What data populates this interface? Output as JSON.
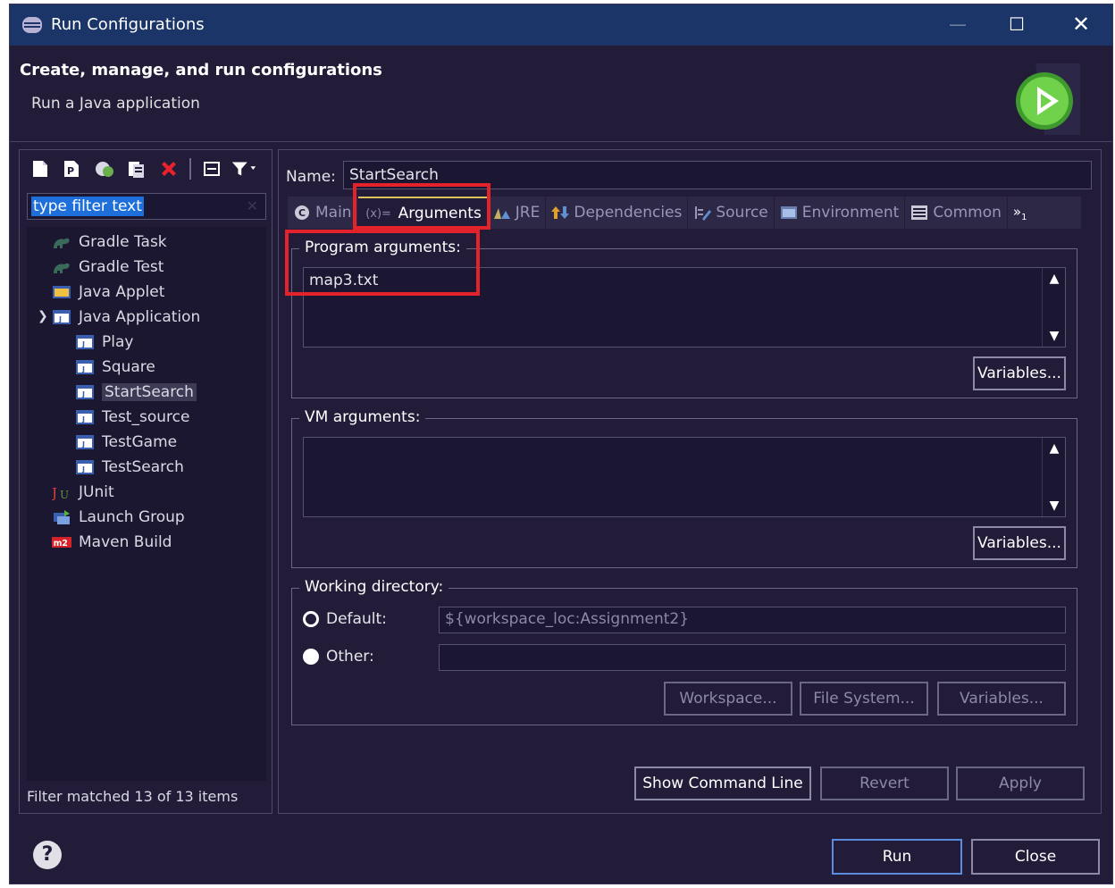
{
  "window": {
    "title": "Run Configurations",
    "controls": {
      "minimize": "—",
      "maximize": "☐",
      "close": "✕"
    }
  },
  "header": {
    "title": "Create, manage, and run configurations",
    "subtitle": "Run a Java application"
  },
  "left": {
    "filter_text": "type filter text",
    "toolbar": [
      "new-configuration-icon",
      "new-prototype-icon",
      "duplicate-icon",
      "export-icon",
      "delete-icon",
      "collapse-all-icon",
      "filter-icon"
    ],
    "tree": [
      {
        "label": "Gradle Task",
        "icon": "gradle-icon",
        "level": 0
      },
      {
        "label": "Gradle Test",
        "icon": "gradle-icon",
        "level": 0
      },
      {
        "label": "Java Applet",
        "icon": "applet-icon",
        "level": 0
      },
      {
        "label": "Java Application",
        "icon": "java-app-icon",
        "level": 0,
        "expanded": true
      },
      {
        "label": "Play",
        "icon": "java-app-icon",
        "level": 1
      },
      {
        "label": "Square",
        "icon": "java-app-icon",
        "level": 1
      },
      {
        "label": "StartSearch",
        "icon": "java-app-icon",
        "level": 1,
        "selected": true
      },
      {
        "label": "Test_source",
        "icon": "java-app-icon",
        "level": 1
      },
      {
        "label": "TestGame",
        "icon": "java-app-icon",
        "level": 1
      },
      {
        "label": "TestSearch",
        "icon": "java-app-icon",
        "level": 1
      },
      {
        "label": "JUnit",
        "icon": "junit-icon",
        "level": 0
      },
      {
        "label": "Launch Group",
        "icon": "launch-group-icon",
        "level": 0
      },
      {
        "label": "Maven Build",
        "icon": "maven-icon",
        "level": 0
      }
    ],
    "status": "Filter matched 13 of 13 items"
  },
  "right": {
    "name_label": "Name:",
    "name_value": "StartSearch",
    "tabs": [
      {
        "label": "Main",
        "icon": "main-tab-icon"
      },
      {
        "label": "Arguments",
        "icon": "arguments-tab-icon",
        "prefix": "(x)=",
        "active": true
      },
      {
        "label": "JRE",
        "icon": "jre-tab-icon"
      },
      {
        "label": "Dependencies",
        "icon": "dependencies-tab-icon"
      },
      {
        "label": "Source",
        "icon": "source-tab-icon"
      },
      {
        "label": "Environment",
        "icon": "environment-tab-icon"
      },
      {
        "label": "Common",
        "icon": "common-tab-icon"
      }
    ],
    "tabs_overflow": "»",
    "tabs_overflow_count": "1",
    "program_args": {
      "legend": "Program arguments:",
      "value": "map3.txt",
      "variables_button": "Variables..."
    },
    "vm_args": {
      "legend": "VM arguments:",
      "value": "",
      "variables_button": "Variables..."
    },
    "working_dir": {
      "legend": "Working directory:",
      "default_label": "Default:",
      "default_value": "${workspace_loc:Assignment2}",
      "other_label": "Other:",
      "other_value": "",
      "workspace_button": "Workspace...",
      "filesystem_button": "File System...",
      "variables_button": "Variables..."
    },
    "buttons": {
      "show_command_line": "Show Command Line",
      "revert": "Revert",
      "apply": "Apply"
    }
  },
  "footer": {
    "help": "?",
    "run": "Run",
    "close": "Close"
  },
  "colors": {
    "background": "#221c39",
    "titlebar": "#1b3568",
    "highlight": "#e3232c",
    "selection": "#1e6fd9"
  }
}
